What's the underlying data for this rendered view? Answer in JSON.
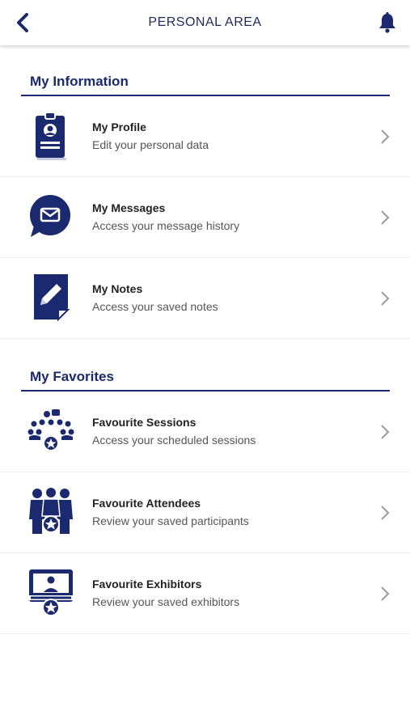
{
  "header": {
    "title": "PERSONAL AREA",
    "back_icon": "chevron-left-icon",
    "bell_icon": "bell-icon"
  },
  "colors": {
    "brand": "#1b2a6e",
    "chevron": "#9a9a9a"
  },
  "sections": [
    {
      "title": "My Information",
      "items": [
        {
          "label": "My Profile",
          "sub": "Edit your personal data",
          "icon": "id-badge-icon"
        },
        {
          "label": "My Messages",
          "sub": "Access your message history",
          "icon": "message-bubble-icon"
        },
        {
          "label": "My Notes",
          "sub": "Access your saved notes",
          "icon": "note-pencil-icon"
        }
      ]
    },
    {
      "title": "My Favorites",
      "items": [
        {
          "label": "Favourite Sessions",
          "sub": "Access your scheduled sessions",
          "icon": "audience-star-icon"
        },
        {
          "label": "Favourite Attendees",
          "sub": "Review your saved participants",
          "icon": "people-star-icon"
        },
        {
          "label": "Favourite Exhibitors",
          "sub": "Review your saved exhibitors",
          "icon": "booth-star-icon"
        }
      ]
    }
  ]
}
